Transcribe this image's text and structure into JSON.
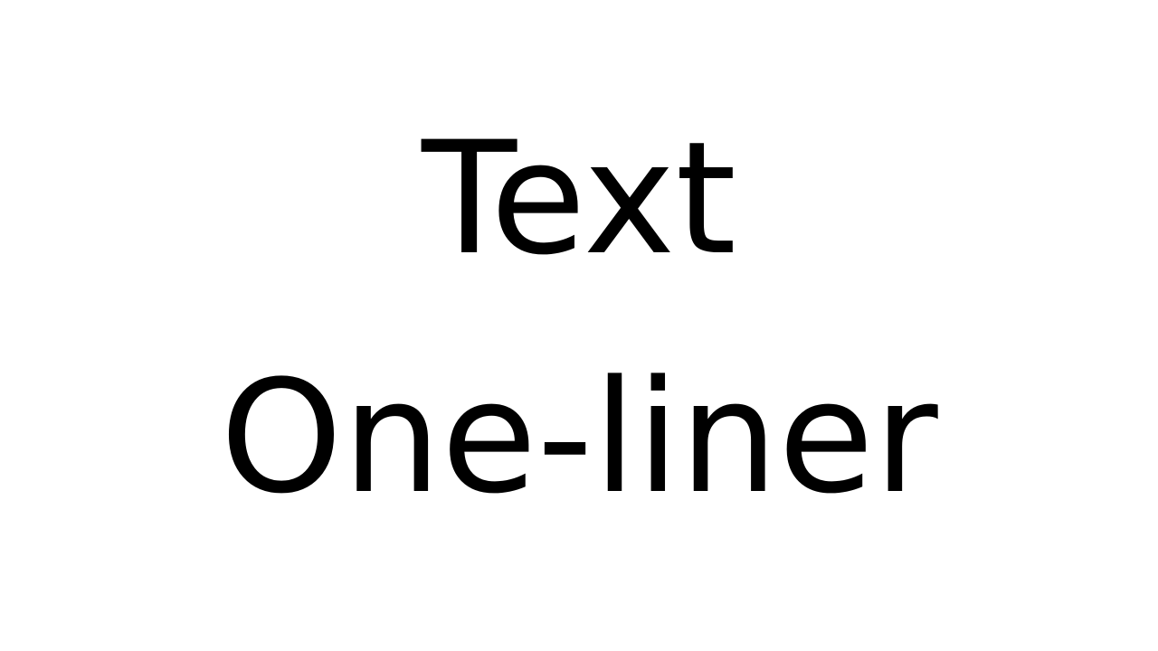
{
  "slide": {
    "background_color": "#ffffff",
    "text_color": "#000000",
    "lines": [
      "Text",
      "One-liner"
    ]
  }
}
